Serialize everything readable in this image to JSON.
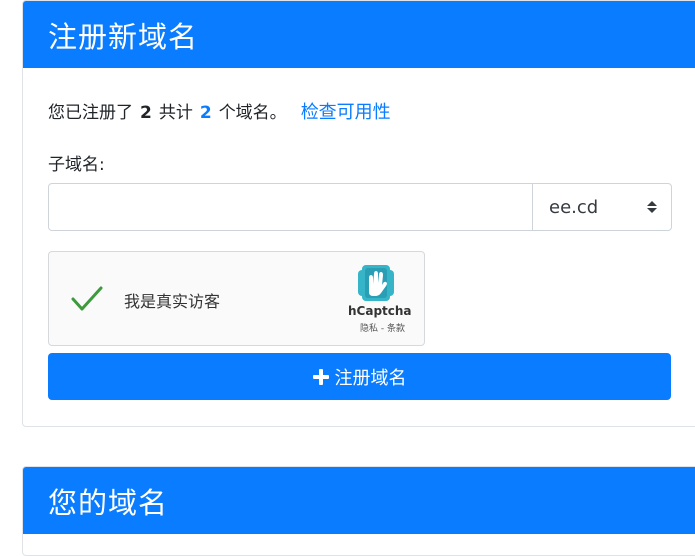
{
  "register_card": {
    "title": "注册新域名",
    "summary": {
      "prefix": "您已注册了",
      "registered_count": "2",
      "middle": "共计",
      "total_count": "2",
      "suffix": "个域名。",
      "check_link": "检查可用性"
    },
    "subdomain_label": "子域名:",
    "subdomain_value": "",
    "domain_select": {
      "selected": "ee.cd"
    },
    "captcha": {
      "label": "我是真实访客",
      "brand": "hCaptcha",
      "links": "隐私 - 条款",
      "checked": true
    },
    "register_button": "注册域名"
  },
  "my_domains_card": {
    "title": "您的域名"
  },
  "colors": {
    "primary": "#0a7cff",
    "check_green": "#3d9a3d",
    "captcha_logo": "#36b5c9"
  },
  "icons": {
    "captcha_check": "checkmark-icon",
    "hcaptcha": "hcaptcha-hand-icon",
    "button": "plus-icon",
    "select": "select-arrows-icon"
  }
}
